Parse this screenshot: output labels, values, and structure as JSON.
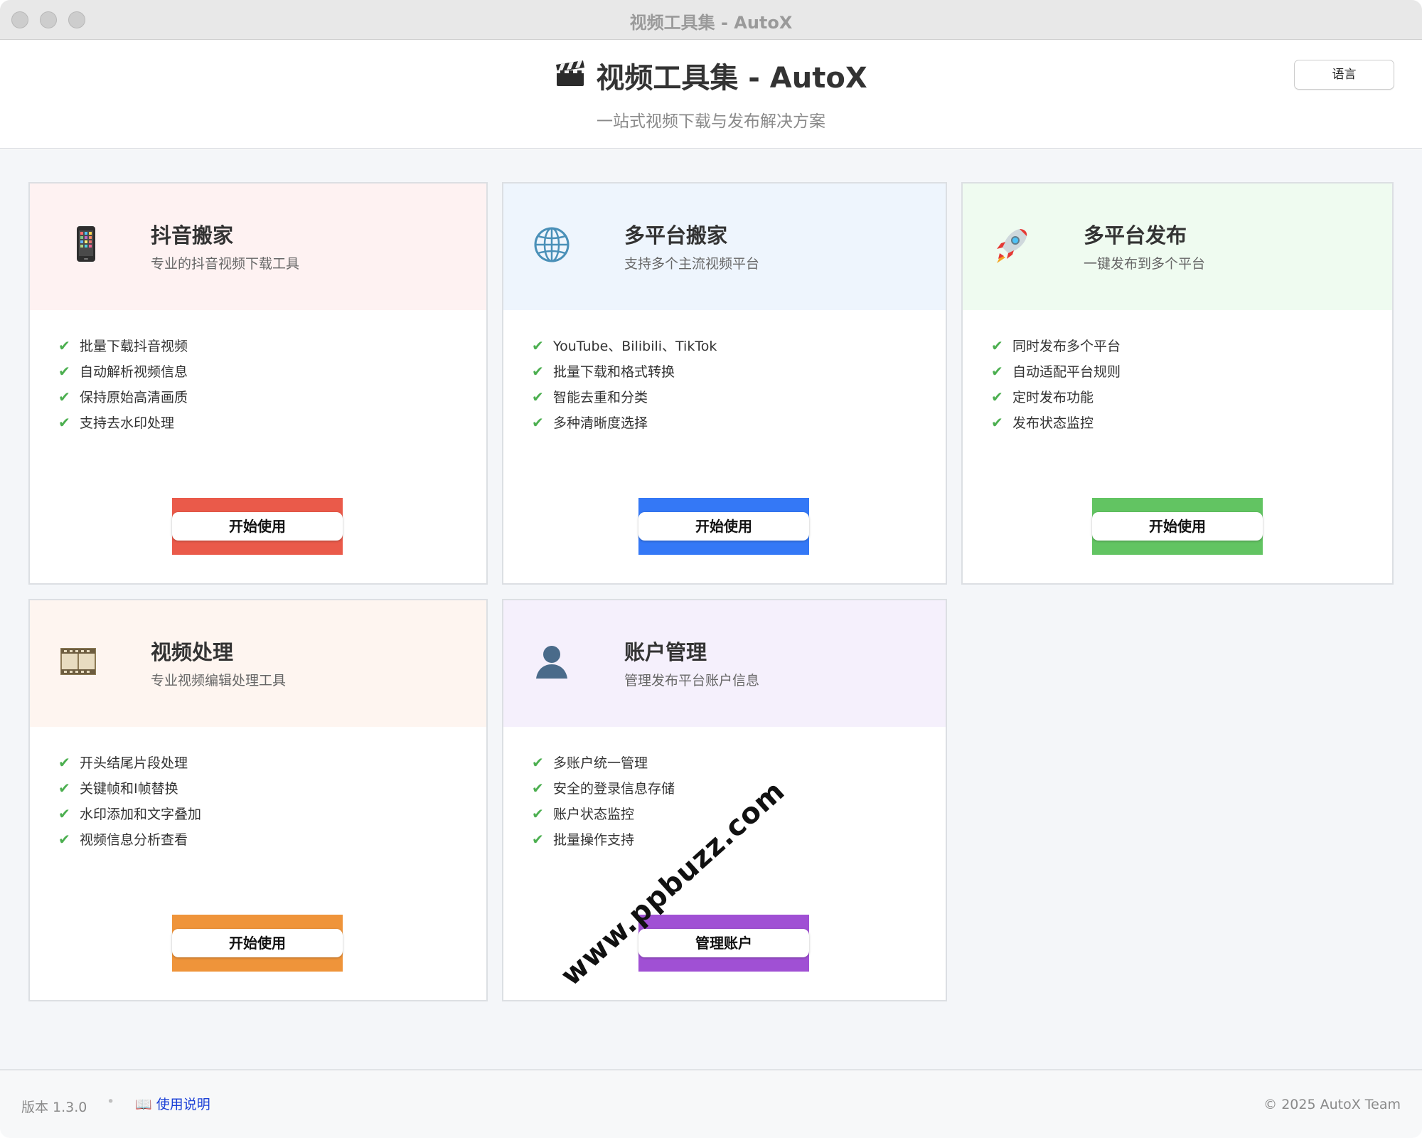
{
  "window": {
    "title": "视频工具集 - AutoX"
  },
  "header": {
    "title": "视频工具集 - AutoX",
    "subtitle": "一站式视频下载与发布解决方案",
    "language_button": "语言"
  },
  "colors": {
    "red": "#ea5a4a",
    "blue": "#3478f6",
    "green": "#62c462",
    "orange": "#ef943a",
    "purple": "#a050d4",
    "check": "#4caf50"
  },
  "cards": [
    {
      "icon": "mobile-phone-icon",
      "title": "抖音搬家",
      "desc": "专业的抖音视频下载工具",
      "features": [
        "批量下载抖音视频",
        "自动解析视频信息",
        "保持原始高清画质",
        "支持去水印处理"
      ],
      "action": "开始使用"
    },
    {
      "icon": "globe-icon",
      "title": "多平台搬家",
      "desc": "支持多个主流视频平台",
      "features": [
        "YouTube、Bilibili、TikTok",
        "批量下载和格式转换",
        "智能去重和分类",
        "多种清晰度选择"
      ],
      "action": "开始使用"
    },
    {
      "icon": "rocket-icon",
      "title": "多平台发布",
      "desc": "一键发布到多个平台",
      "features": [
        "同时发布多个平台",
        "自动适配平台规则",
        "定时发布功能",
        "发布状态监控"
      ],
      "action": "开始使用"
    },
    {
      "icon": "film-reel-icon",
      "title": "视频处理",
      "desc": "专业视频编辑处理工具",
      "features": [
        "开头结尾片段处理",
        "关键帧和I帧替换",
        "水印添加和文字叠加",
        "视频信息分析查看"
      ],
      "action": "开始使用"
    },
    {
      "icon": "user-silhouette-icon",
      "title": "账户管理",
      "desc": "管理发布平台账户信息",
      "features": [
        "多账户统一管理",
        "安全的登录信息存储",
        "账户状态监控",
        "批量操作支持"
      ],
      "action": "管理账户"
    }
  ],
  "footer": {
    "version": "版本 1.3.0",
    "separator": "•",
    "help_icon": "📖",
    "help": "使用说明",
    "copyright": "© 2025 AutoX Team"
  },
  "watermark": "www.ppbuzz.com"
}
